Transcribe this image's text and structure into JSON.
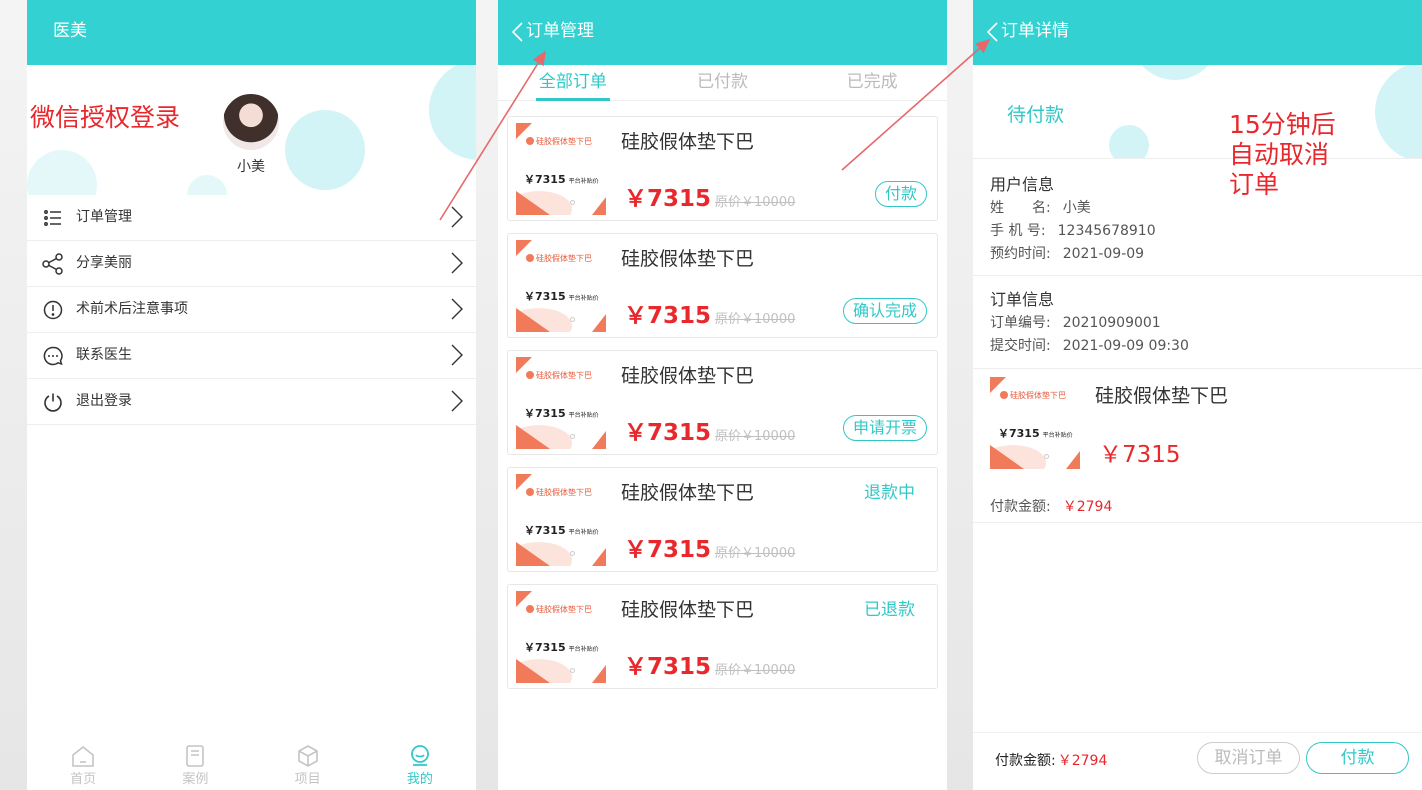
{
  "annotations": {
    "wechat_login": "微信授权登录",
    "auto_cancel": [
      "15分钟后",
      "自动取消",
      "订单"
    ]
  },
  "screen1": {
    "title": "医美",
    "user_name": "小美",
    "menu": [
      {
        "label": "订单管理",
        "icon": "list-icon"
      },
      {
        "label": "分享美丽",
        "icon": "share-icon"
      },
      {
        "label": "术前术后注意事项",
        "icon": "alert-icon"
      },
      {
        "label": "联系医生",
        "icon": "chat-icon"
      },
      {
        "label": "退出登录",
        "icon": "power-icon"
      }
    ],
    "tabbar": [
      {
        "label": "首页",
        "icon": "home-icon",
        "active": false
      },
      {
        "label": "案例",
        "icon": "book-icon",
        "active": false
      },
      {
        "label": "项目",
        "icon": "cube-icon",
        "active": false
      },
      {
        "label": "我的",
        "icon": "profile-icon",
        "active": true
      }
    ]
  },
  "screen2": {
    "title": "订单管理",
    "tabs": [
      "全部订单",
      "已付款",
      "已完成"
    ],
    "product_thumb": {
      "tag": "硅胶假体垫下巴",
      "price": "￥7315",
      "price_note": "平台补贴价"
    },
    "orders": [
      {
        "name": "硅胶假体垫下巴",
        "price": "￥7315",
        "original": "原价￥10000",
        "action": "付款",
        "status": ""
      },
      {
        "name": "硅胶假体垫下巴",
        "price": "￥7315",
        "original": "原价￥10000",
        "action": "确认完成",
        "status": ""
      },
      {
        "name": "硅胶假体垫下巴",
        "price": "￥7315",
        "original": "原价￥10000",
        "action": "申请开票",
        "status": ""
      },
      {
        "name": "硅胶假体垫下巴",
        "price": "￥7315",
        "original": "原价￥10000",
        "action": "",
        "status": "退款中"
      },
      {
        "name": "硅胶假体垫下巴",
        "price": "￥7315",
        "original": "原价￥10000",
        "action": "",
        "status": "已退款"
      }
    ]
  },
  "screen3": {
    "title": "订单详情",
    "status": "待付款",
    "user_info": {
      "heading": "用户信息",
      "name_label": "姓　　名:",
      "name": "小美",
      "phone_label": "手 机 号:",
      "phone": "12345678910",
      "date_label": "预约时间:",
      "date": "2021-09-09"
    },
    "order_info": {
      "heading": "订单信息",
      "no_label": "订单编号:",
      "no": "20210909001",
      "time_label": "提交时间:",
      "time": "2021-09-09  09:30"
    },
    "product": {
      "name": "硅胶假体垫下巴",
      "price": "￥7315"
    },
    "payment": {
      "label": "付款金额:",
      "amount": "￥2794"
    },
    "bottom": {
      "label": "付款金额:",
      "amount": "￥2794",
      "cancel": "取消订单",
      "pay": "付款"
    }
  },
  "colors": {
    "accent": "#33d1d1",
    "price": "#e8282c",
    "annotation": "#e8282c"
  }
}
